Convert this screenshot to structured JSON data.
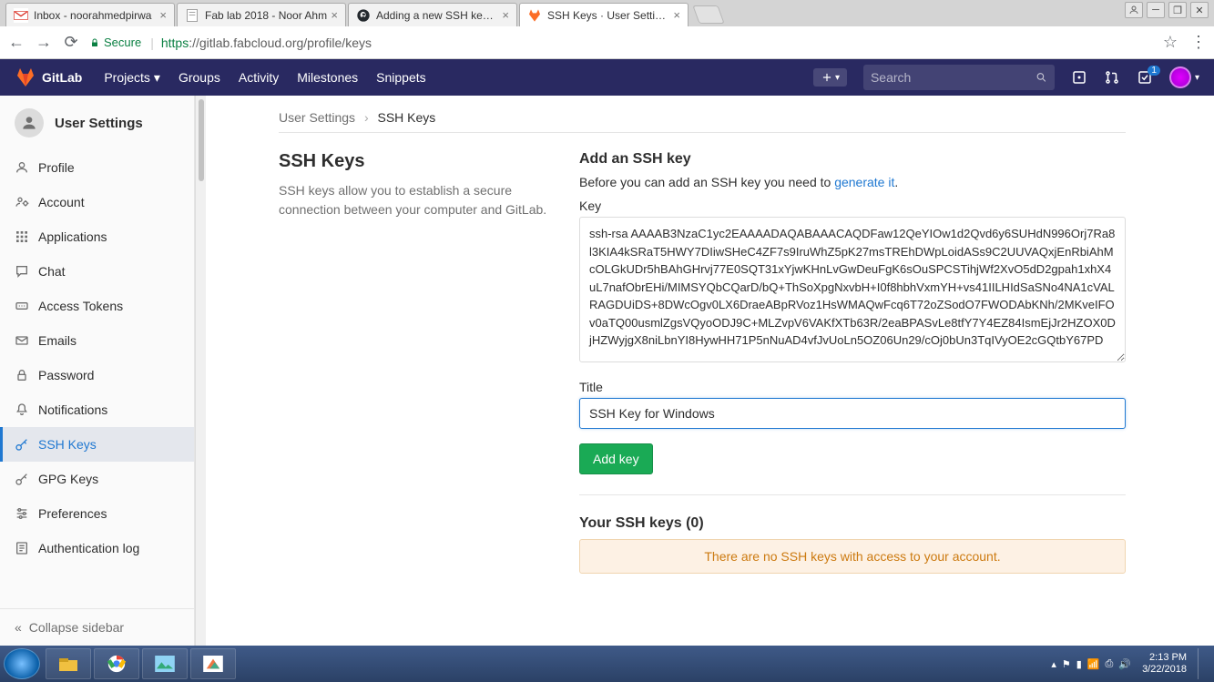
{
  "chrome": {
    "tabs": [
      {
        "title": "Inbox - noorahmedpirwa",
        "favicon": "gmail"
      },
      {
        "title": "Fab lab 2018 - Noor Ahm",
        "favicon": "doc"
      },
      {
        "title": "Adding a new SSH key to",
        "favicon": "github"
      },
      {
        "title": "SSH Keys · User Settings",
        "favicon": "gitlab"
      }
    ],
    "secure_label": "Secure",
    "url_proto": "https",
    "url_rest": "://gitlab.fabcloud.org/profile/keys"
  },
  "navbar": {
    "brand": "GitLab",
    "items": [
      "Projects",
      "Groups",
      "Activity",
      "Milestones",
      "Snippets"
    ],
    "search_placeholder": "Search",
    "todo_count": "1"
  },
  "sidebar": {
    "header": "User Settings",
    "items": [
      {
        "icon": "profile",
        "label": "Profile"
      },
      {
        "icon": "account",
        "label": "Account"
      },
      {
        "icon": "apps",
        "label": "Applications"
      },
      {
        "icon": "chat",
        "label": "Chat"
      },
      {
        "icon": "token",
        "label": "Access Tokens"
      },
      {
        "icon": "email",
        "label": "Emails"
      },
      {
        "icon": "lock",
        "label": "Password"
      },
      {
        "icon": "bell",
        "label": "Notifications"
      },
      {
        "icon": "key",
        "label": "SSH Keys"
      },
      {
        "icon": "key",
        "label": "GPG Keys"
      },
      {
        "icon": "prefs",
        "label": "Preferences"
      },
      {
        "icon": "log",
        "label": "Authentication log"
      }
    ],
    "collapse": "Collapse sidebar"
  },
  "breadcrumb": {
    "root": "User Settings",
    "current": "SSH Keys"
  },
  "page": {
    "title": "SSH Keys",
    "desc": "SSH keys allow you to establish a secure connection between your computer and GitLab.",
    "add_title": "Add an SSH key",
    "add_desc_before": "Before you can add an SSH key you need to ",
    "add_desc_link": "generate it",
    "key_label": "Key",
    "key_value": "ssh-rsa AAAAB3NzaC1yc2EAAAADAQABAAACAQDFaw12QeYIOw1d2Qvd6y6SUHdN996Orj7Ra8l3KIA4kSRaT5HWY7DIiwSHeC4ZF7s9IruWhZ5pK27msTREhDWpLoidASs9C2UUVAQxjEnRbiAhMcOLGkUDr5hBAhGHrvj77E0SQT31xYjwKHnLvGwDeuFgK6sOuSPCSTihjWf2XvO5dD2gpah1xhX4uL7nafObrEHi/MIMSYQbCQarD/bQ+ThSoXpgNxvbH+I0f8hbhVxmYH+vs41IILHIdSaSNo4NA1cVALRAGDUiDS+8DWcOgv0LX6DraeABpRVoz1HsWMAQwFcq6T72oZSodO7FWODAbKNh/2MKveIFOv0aTQ00usmlZgsVQyoODJ9C+MLZvpV6VAKfXTb63R/2eaBPASvLe8tfY7Y4EZ84IsmEjJr2HZOX0DjHZWyjgX8niLbnYI8HywHH71P5nNuAD4vfJvUoLn5OZ06Un29/cOj0bUn3TqIVyOE2cGQtbY67PD",
    "title_label": "Title",
    "title_value": "SSH Key for Windows",
    "add_btn": "Add key",
    "list_title": "Your SSH keys (0)",
    "empty_msg": "There are no SSH keys with access to your account."
  },
  "taskbar": {
    "time": "2:13 PM",
    "date": "3/22/2018"
  }
}
